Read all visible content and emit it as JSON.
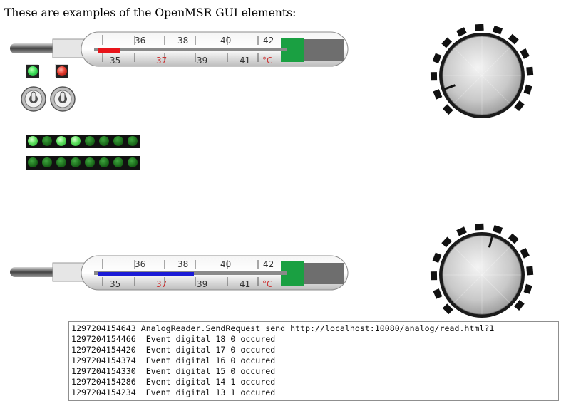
{
  "page": {
    "heading": "These are examples of the OpenMSR GUI elements:"
  },
  "thermometers": [
    {
      "name": "thermometer-top",
      "upper_scale": [
        "36",
        "38",
        "40",
        "42"
      ],
      "lower_scale": [
        "35",
        "37",
        "39",
        "41"
      ],
      "unit": "°C",
      "indicator_color": "#e8141a",
      "level": 0.12
    },
    {
      "name": "thermometer-bottom",
      "upper_scale": [
        "36",
        "38",
        "40",
        "42"
      ],
      "lower_scale": [
        "35",
        "37",
        "39",
        "41"
      ],
      "unit": "°C",
      "indicator_color": "#1a1ad6",
      "level": 0.5
    }
  ],
  "leds": [
    {
      "name": "led-green",
      "color": "green",
      "state": "on"
    },
    {
      "name": "led-red",
      "color": "red",
      "state": "on"
    }
  ],
  "switches": [
    {
      "name": "toggle-switch-1",
      "state": "off"
    },
    {
      "name": "toggle-switch-2",
      "state": "off"
    }
  ],
  "led_bars": [
    {
      "name": "led-bar-1",
      "states": [
        1,
        0,
        1,
        1,
        0,
        0,
        0,
        0
      ]
    },
    {
      "name": "led-bar-2",
      "states": [
        0,
        0,
        0,
        0,
        0,
        0,
        0,
        0
      ]
    }
  ],
  "knobs": [
    {
      "name": "knob-top",
      "pointer_angle_deg": 250
    },
    {
      "name": "knob-bottom",
      "pointer_angle_deg": 15
    }
  ],
  "log": {
    "lines": [
      "1297204154643 AnalogReader.SendRequest send http://localhost:10080/analog/read.html?1",
      "1297204154466  Event digital 18 0 occured",
      "1297204154420  Event digital 17 0 occured",
      "1297204154374  Event digital 16 0 occured",
      "1297204154330  Event digital 15 0 occured",
      "1297204154286  Event digital 14 1 occured",
      "1297204154234  Event digital 13 1 occured"
    ]
  }
}
